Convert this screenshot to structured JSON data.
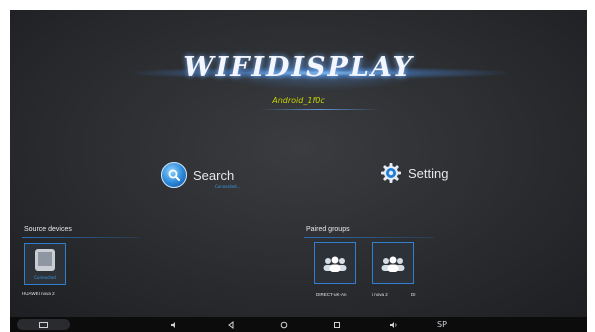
{
  "app": {
    "logo_text": "WIFIDISPLAY",
    "device_name": "Android_1f0c"
  },
  "actions": {
    "search_label": "Search",
    "search_status": "Connected...",
    "setting_label": "Setting"
  },
  "source_devices": {
    "title": "Source devices",
    "items": [
      {
        "name": "HUAWEI nova 2",
        "status": "Connected"
      }
    ]
  },
  "paired_groups": {
    "title": "Paired groups",
    "items": [
      {
        "name": "DIRECT-uK-An"
      },
      {
        "name": "i nova 2"
      },
      {
        "name": "DI"
      }
    ]
  },
  "navbar": {
    "icons": [
      "screen-icon",
      "volume-down-icon",
      "back-icon",
      "home-icon",
      "recent-apps-icon",
      "volume-up-icon"
    ],
    "sp_label": "SP"
  }
}
